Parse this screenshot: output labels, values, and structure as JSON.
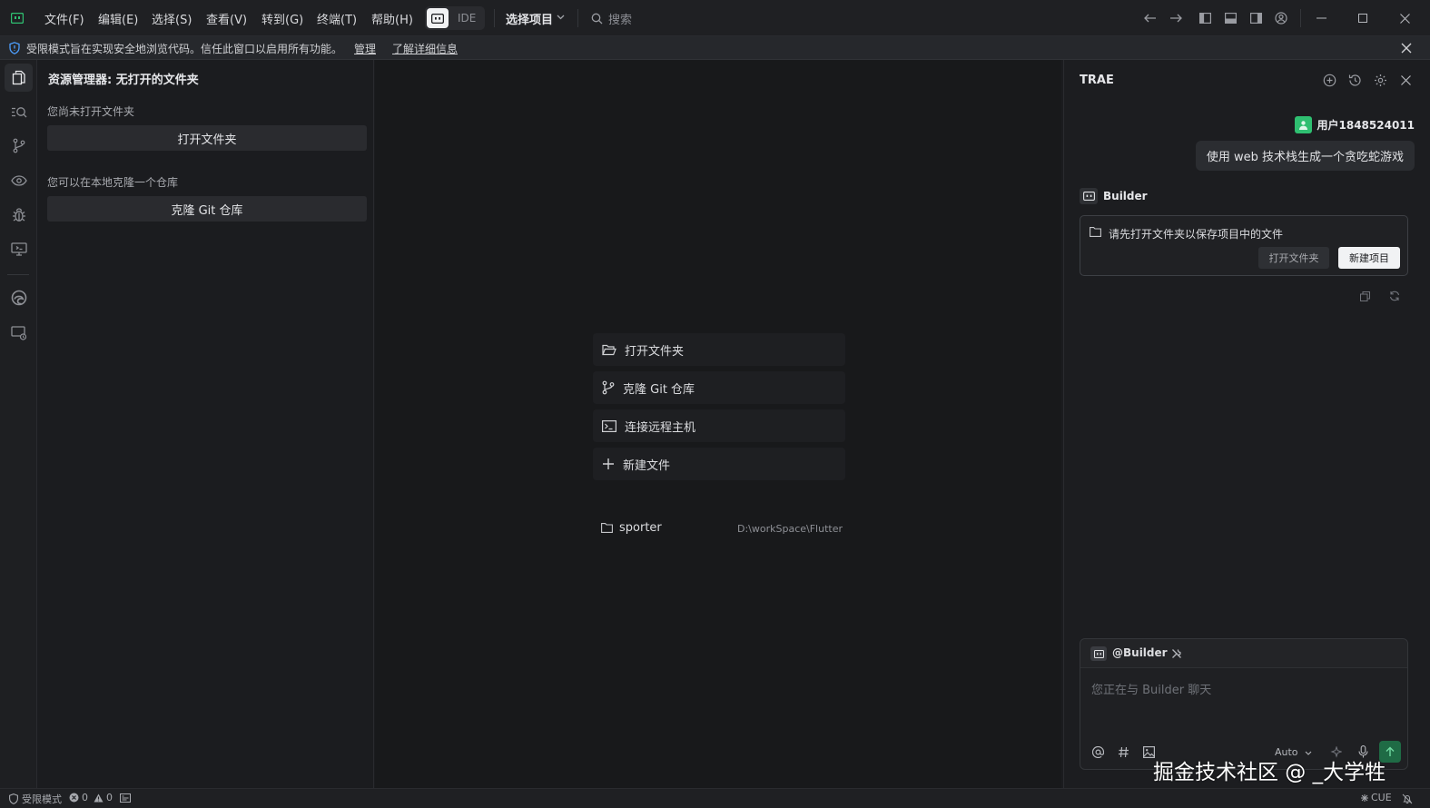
{
  "titlebar": {
    "menus": [
      "文件(F)",
      "编辑(E)",
      "选择(S)",
      "查看(V)",
      "转到(G)",
      "终端(T)",
      "帮助(H)"
    ],
    "mode_label": "IDE",
    "project_select": "选择项目",
    "search_placeholder": "搜索"
  },
  "banner": {
    "message": "受限模式旨在实现安全地浏览代码。信任此窗口以启用所有功能。",
    "manage_link": "管理",
    "learn_more_link": "了解详细信息"
  },
  "sidebar": {
    "title": "资源管理器: 无打开的文件夹",
    "no_folder_text": "您尚未打开文件夹",
    "open_folder_button": "打开文件夹",
    "clone_hint": "您可以在本地克隆一个仓库",
    "clone_button": "克隆 Git 仓库"
  },
  "welcome": {
    "actions": [
      {
        "label": "打开文件夹",
        "icon": "folder-open-icon"
      },
      {
        "label": "克隆 Git 仓库",
        "icon": "git-branch-icon"
      },
      {
        "label": "连接远程主机",
        "icon": "remote-terminal-icon"
      },
      {
        "label": "新建文件",
        "icon": "plus-icon"
      }
    ],
    "recent": [
      {
        "name": "sporter",
        "path": "D:\\workSpace\\Flutter"
      }
    ]
  },
  "panel": {
    "title": "TRAE",
    "user_name": "用户1848524011",
    "user_message": "使用 web 技术栈生成一个贪吃蛇游戏",
    "agent_name": "Builder",
    "notice_text": "请先打开文件夹以保存项目中的文件",
    "open_folder_button": "打开文件夹",
    "new_project_button": "新建项目",
    "input_agent_tag": "@Builder",
    "input_placeholder": "您正在与 Builder 聊天",
    "model_select": "Auto"
  },
  "statusbar": {
    "restricted_mode": "受限模式",
    "errors": "0",
    "warnings": "0",
    "language": "CUE"
  },
  "watermark": "掘金技术社区 @ _大学牲",
  "colors": {
    "accent_green": "#2fbf71",
    "background": "#1b1c1f"
  }
}
